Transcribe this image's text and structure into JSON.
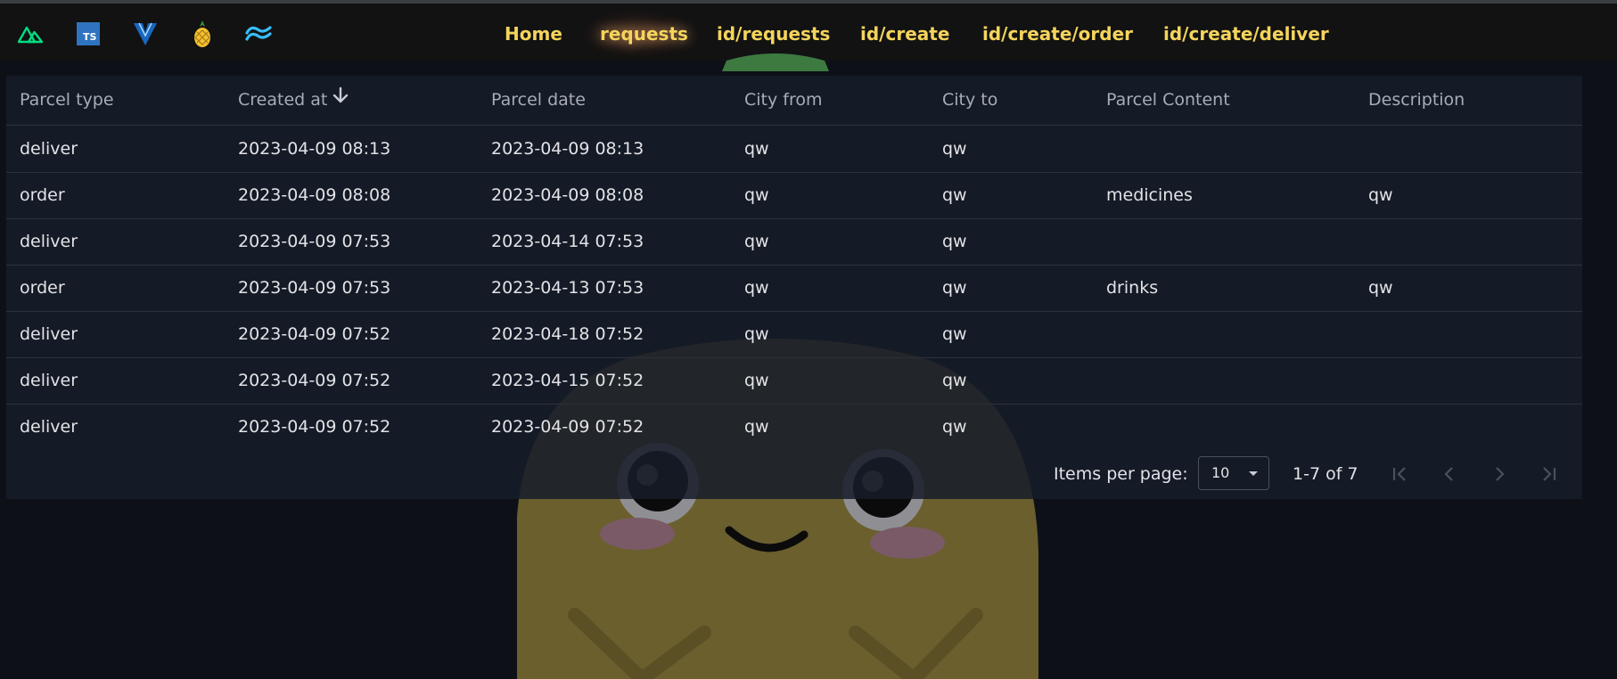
{
  "nav": {
    "icons": [
      "nuxt-icon",
      "typescript-icon",
      "vuetify-icon",
      "pineapple-icon",
      "tailwind-icon"
    ],
    "ts_text": "TS",
    "links": [
      "Home",
      "requests",
      "id/requests",
      "id/create",
      "id/create/order",
      "id/create/deliver"
    ],
    "active_link": "requests"
  },
  "table": {
    "headers": [
      "Parcel type",
      "Created at",
      "Parcel date",
      "City from",
      "City to",
      "Parcel Content",
      "Description"
    ],
    "sort_column": "Created at",
    "sort_direction": "desc",
    "rows": [
      [
        "deliver",
        "2023-04-09 08:13",
        "2023-04-09 08:13",
        "qw",
        "qw",
        "",
        ""
      ],
      [
        "order",
        "2023-04-09 08:08",
        "2023-04-09 08:08",
        "qw",
        "qw",
        "medicines",
        "qw"
      ],
      [
        "deliver",
        "2023-04-09 07:53",
        "2023-04-14 07:53",
        "qw",
        "qw",
        "",
        ""
      ],
      [
        "order",
        "2023-04-09 07:53",
        "2023-04-13 07:53",
        "qw",
        "qw",
        "drinks",
        "qw"
      ],
      [
        "deliver",
        "2023-04-09 07:52",
        "2023-04-18 07:52",
        "qw",
        "qw",
        "",
        ""
      ],
      [
        "deliver",
        "2023-04-09 07:52",
        "2023-04-15 07:52",
        "qw",
        "qw",
        "",
        ""
      ],
      [
        "deliver",
        "2023-04-09 07:52",
        "2023-04-09 07:52",
        "qw",
        "qw",
        "",
        ""
      ]
    ]
  },
  "footer": {
    "items_per_page_label": "Items per page:",
    "items_per_page_value": "10",
    "range_text": "1-7 of 7",
    "buttons": [
      "first-page-icon",
      "previous-page-icon",
      "next-page-icon",
      "last-page-icon"
    ]
  },
  "colors": {
    "background": "#0d1117",
    "navbar": "#121212",
    "nav_link": "#f4d45c",
    "table_bg": "#161c29",
    "mascot_body": "#6b5f2e"
  }
}
